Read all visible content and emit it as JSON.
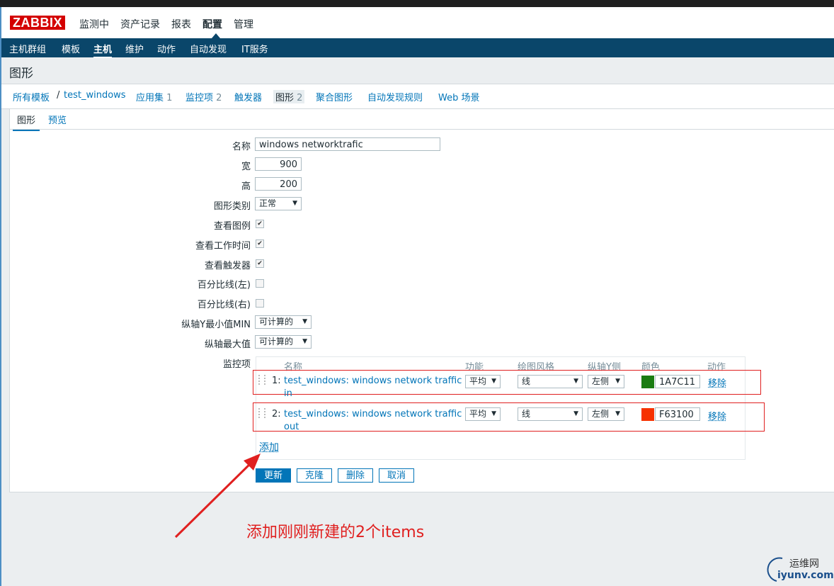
{
  "app": {
    "logo": "ZABBIX"
  },
  "main_menu": [
    "监测中",
    "资产记录",
    "报表",
    "配置",
    "管理"
  ],
  "main_menu_active": "配置",
  "sub_menu": [
    "主机群组",
    "模板",
    "主机",
    "维护",
    "动作",
    "自动发现",
    "IT服务"
  ],
  "sub_menu_active": "主机",
  "page_title": "图形",
  "breadcrumb": {
    "all_templates": "所有模板",
    "sep": "/",
    "host": "test_windows",
    "applications": "应用集",
    "applications_count": "1",
    "items": "监控项",
    "items_count": "2",
    "triggers": "触发器",
    "graphs": "图形",
    "graphs_count": "2",
    "screens": "聚合图形",
    "discovery": "自动发现规则",
    "web": "Web 场景"
  },
  "tabs": {
    "graph": "图形",
    "preview": "预览"
  },
  "form": {
    "name_label": "名称",
    "name_value": "windows networktrafic",
    "width_label": "宽",
    "width_value": "900",
    "height_label": "高",
    "height_value": "200",
    "type_label": "图形类别",
    "type_value": "正常",
    "legend_label": "查看图例",
    "legend_checked": true,
    "worktime_label": "查看工作时间",
    "worktime_checked": true,
    "triggers_label": "查看触发器",
    "triggers_checked": true,
    "percent_left_label": "百分比线(左)",
    "percent_left_checked": false,
    "percent_right_label": "百分比线(右)",
    "percent_right_checked": false,
    "ymin_label": "纵轴Y最小值MIN",
    "ymin_value": "可计算的",
    "ymax_label": "纵轴最大值",
    "ymax_value": "可计算的",
    "items_label": "监控项"
  },
  "items_table": {
    "headers": {
      "name": "名称",
      "function": "功能",
      "style": "绘图风格",
      "yaxis": "纵轴Y侧",
      "color": "颜色",
      "action": "动作"
    },
    "rows": [
      {
        "index": "1:",
        "name": "test_windows: windows network traffic in",
        "function": "平均",
        "style": "线",
        "yaxis": "左侧",
        "color": "1A7C11",
        "color_hex": "#1A7C11",
        "action": "移除"
      },
      {
        "index": "2:",
        "name": "test_windows: windows network traffic out",
        "function": "平均",
        "style": "线",
        "yaxis": "左侧",
        "color": "F63100",
        "color_hex": "#F63100",
        "action": "移除"
      }
    ],
    "add_label": "添加"
  },
  "buttons": {
    "update": "更新",
    "clone": "克隆",
    "delete": "删除",
    "cancel": "取消"
  },
  "annotation": "添加刚刚新建的2个items",
  "watermark": {
    "line1": "运维网",
    "line2": "iyunv.com"
  },
  "colors": {
    "accent": "#0275b8",
    "submenu_bg": "#0a466a",
    "logo_red": "#d40000",
    "annotation_red": "#e02020"
  }
}
